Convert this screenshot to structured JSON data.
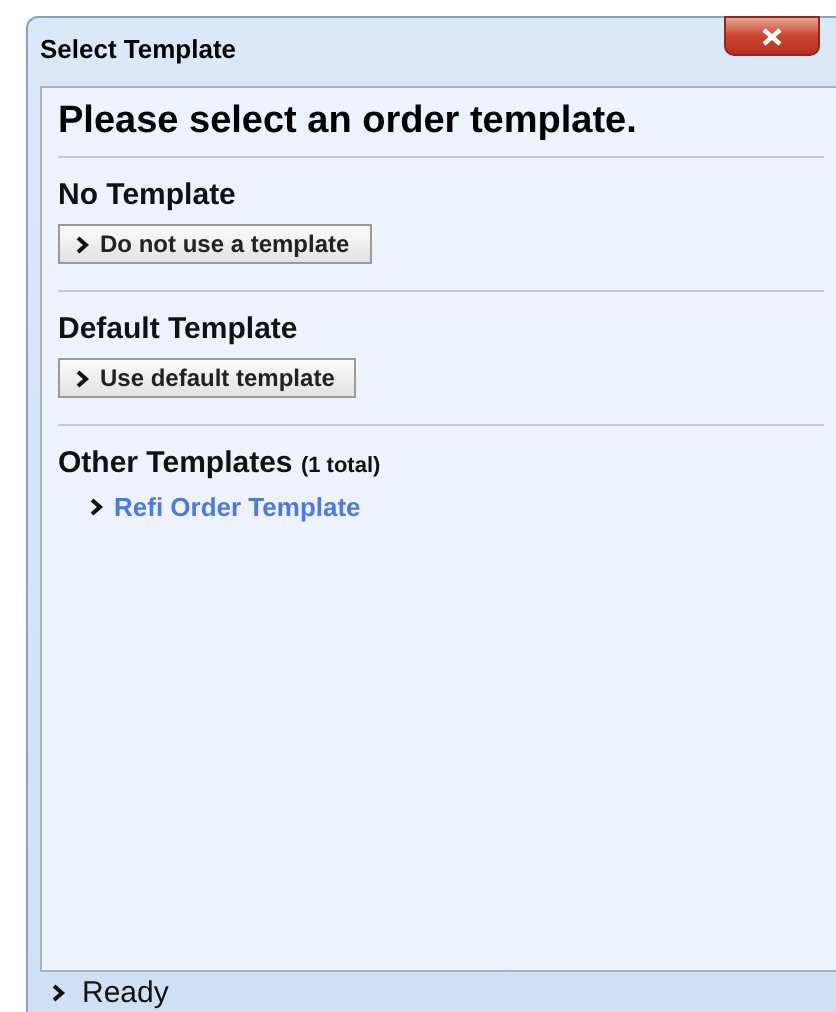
{
  "window": {
    "title": "Select Template"
  },
  "heading": "Please select an order template.",
  "sections": [
    {
      "kind": "button",
      "title": "No Template",
      "action": "Do not use a template"
    },
    {
      "kind": "button",
      "title": "Default Template",
      "action": "Use default template"
    },
    {
      "kind": "links",
      "title": "Other Templates",
      "count": "(1 total)",
      "links": [
        "Refi Order Template"
      ]
    }
  ],
  "status_bar": "Ready"
}
